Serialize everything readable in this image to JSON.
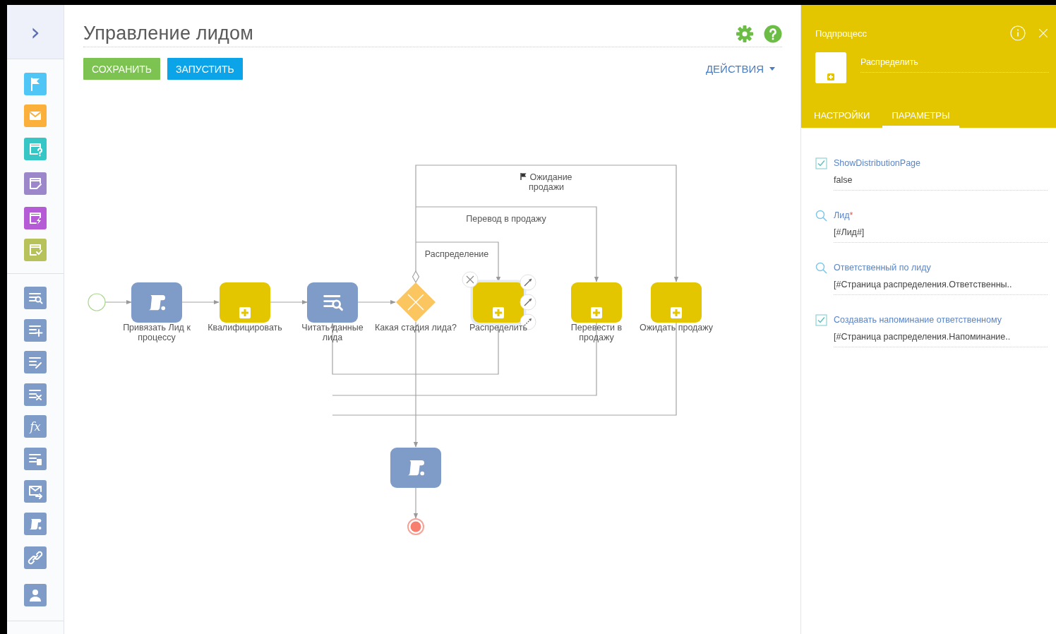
{
  "sidebar": {
    "expand_glyph": "›",
    "groups": [
      {
        "items": [
          {
            "kind": "flag",
            "color": "#4fc6f5"
          },
          {
            "kind": "mail",
            "color": "#fbb03b"
          },
          {
            "kind": "question-card",
            "color": "#36c6c6"
          },
          {
            "kind": "edit-card",
            "color": "#9b87c9"
          },
          {
            "kind": "bolt-card",
            "color": "#b65bd6"
          },
          {
            "kind": "check-card",
            "color": "#b7c25a"
          }
        ]
      },
      {
        "items": [
          {
            "kind": "read-data",
            "color": "#7f9bc7"
          },
          {
            "kind": "add-data",
            "color": "#7f9bc7"
          },
          {
            "kind": "modify-data",
            "color": "#7f9bc7"
          },
          {
            "kind": "delete-data",
            "color": "#7f9bc7"
          },
          {
            "kind": "formula",
            "color": "#7f9bc7",
            "glyph": "fx"
          },
          {
            "kind": "document",
            "color": "#7f9bc7"
          },
          {
            "kind": "send-mail",
            "color": "#7f9bc7"
          },
          {
            "kind": "script",
            "color": "#7f9bc7"
          },
          {
            "kind": "link",
            "color": "#7f9bc7"
          },
          {
            "kind": "user",
            "color": "#7f9bc7"
          }
        ]
      }
    ]
  },
  "header": {
    "title": "Управление лидом"
  },
  "toolbar": {
    "buttons": [
      {
        "kind": "save",
        "label": "СОХРАНИТЬ"
      },
      {
        "kind": "run",
        "label": "ЗАПУСТИТЬ"
      }
    ],
    "actions": "ДЕЙСТВИЯ"
  },
  "diagram": {
    "nodes": [
      {
        "kind": "start",
        "selected": false
      },
      {
        "kind": "script",
        "label": "Привязать Лид к процессу",
        "selected": false
      },
      {
        "kind": "subprocess",
        "label": "Квалифицировать",
        "selected": false
      },
      {
        "kind": "read-data",
        "label": "Читать данные лида",
        "selected": false
      },
      {
        "kind": "gateway",
        "label": "Какая стадия лида?",
        "selected": false
      },
      {
        "kind": "subprocess",
        "label": "Распределить",
        "selected": true
      },
      {
        "kind": "subprocess",
        "label": "Перевести в продажу",
        "selected": false
      },
      {
        "kind": "subprocess",
        "label": "Ожидать продажу",
        "selected": false
      },
      {
        "kind": "script",
        "selected": false
      },
      {
        "kind": "end",
        "selected": false
      }
    ],
    "flows": [
      {
        "label": "Ожидание продажи",
        "flag": true
      },
      {
        "label": "Перевод в продажу",
        "flag": false
      },
      {
        "label": "Распределение",
        "flag": false
      }
    ]
  },
  "panel": {
    "type": "Подпроцесс",
    "name": "Распределить",
    "tabs": [
      {
        "label": "НАСТРОЙКИ",
        "selected": false
      },
      {
        "label": "ПАРАМЕТРЫ",
        "selected": true
      }
    ],
    "params": [
      {
        "kind": "boolean",
        "label": "ShowDistributionPage",
        "checked": true,
        "value": "false"
      },
      {
        "kind": "lookup",
        "label": "Лид",
        "required_mark": "*",
        "value": "[#Лид#]"
      },
      {
        "kind": "lookup",
        "label": "Ответственный по лиду",
        "value": "[#Страница распределения.Ответственны.."
      },
      {
        "kind": "boolean",
        "label": "Создавать напоминание ответственному",
        "checked": true,
        "value": "[#Страница распределения.Напоминание.."
      }
    ]
  }
}
